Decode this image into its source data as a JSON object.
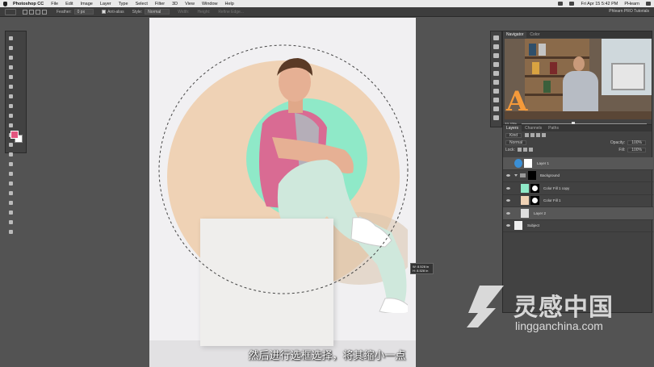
{
  "menubar": {
    "app_name": "Photoshop CC",
    "items": [
      "File",
      "Edit",
      "Image",
      "Layer",
      "Type",
      "Select",
      "Filter",
      "3D",
      "View",
      "Window",
      "Help"
    ],
    "datetime": "Fri Apr 15  5:42 PM",
    "user": "PHearn"
  },
  "options_bar": {
    "feather_label": "Feather:",
    "feather_value": "0 px",
    "anti_alias_label": "Anti-alias",
    "style_label": "Style:",
    "style_value": "Normal",
    "width_label": "Width:",
    "height_label": "Height:",
    "refine_edge_label": "Refine Edge...",
    "workspace": "Phlearn PRO Tutorials"
  },
  "readout": {
    "w": "W: 8.528 in",
    "h": "H: 8.528 in"
  },
  "subtitle": "然后进行选框选择，将其缩小一点",
  "navigator": {
    "tabs": [
      "Navigator",
      "Color"
    ],
    "zoom": "33.33%"
  },
  "layers_panel": {
    "tabs": [
      "Layers",
      "Channels",
      "Paths"
    ],
    "kind_label": "Kind",
    "blend_mode": "Normal",
    "opacity_label": "Opacity:",
    "opacity_value": "100%",
    "lock_label": "Lock:",
    "fill_label": "Fill:",
    "fill_value": "100%",
    "layers": [
      {
        "name": "Layer 1",
        "selected": true,
        "thumb": "#3a8fd6"
      },
      {
        "name": "Background",
        "type": "group"
      },
      {
        "name": "Color Fill 1 copy",
        "thumb": "#8fe9c8",
        "mask": true
      },
      {
        "name": "Color Fill 1",
        "thumb": "#efd2b5",
        "mask": true
      },
      {
        "name": "Layer 2",
        "selected": true,
        "thumb": "#dedede"
      },
      {
        "name": "Subject",
        "thumb": "#eeeeee"
      }
    ]
  },
  "watermark": {
    "cn": "灵感中国",
    "en": "lingganchina.com"
  },
  "colors": {
    "foreground": "#e2557f",
    "background": "#ffffff",
    "tan_circle": "#efd2b5",
    "mint_circle": "#8fe9c8"
  }
}
